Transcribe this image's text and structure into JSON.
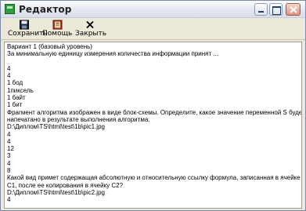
{
  "window": {
    "title": "Редактор"
  },
  "toolbar": {
    "save_label": "Сохранить",
    "help_label": "Помощь",
    "close_label": "Закрыть"
  },
  "content": {
    "lines": [
      "Вариант 1 (базовый уровень)",
      "За минимальную единицу измерения количества информации принят ...",
      "",
      "4",
      "4",
      "1 бод",
      "1пиксель",
      "1 байт",
      "1 бит",
      "Фрагмент алгоритма изображен в виде блок-схемы. Определите, какое значение переменной S будет",
      "напечатано в результате выполнения алгоритма.",
      "D:\\Диплом\\TS\\html\\test\\1b\\pic1.jpg",
      "4",
      "4",
      "12",
      "3",
      "4",
      "8",
      "Какой вид примет содержащая абсолютную и относительную ссылку формула, записанная в ячейке",
      "C1, после ее копирования в ячейку C2?",
      "D:\\Диплом\\TS\\html\\test\\1b\\pic2.jpg",
      "4"
    ]
  }
}
